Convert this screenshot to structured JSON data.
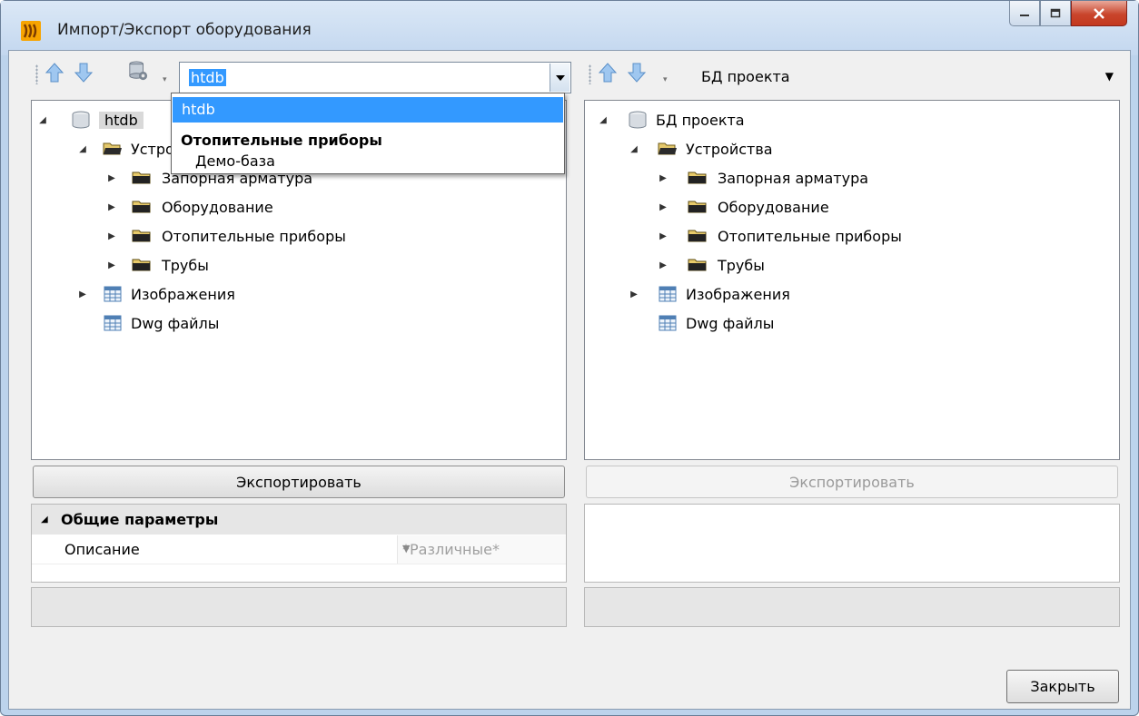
{
  "window": {
    "title": "Импорт/Экспорт оборудования",
    "accent_color": "#3399ff"
  },
  "left": {
    "db_combo": "htdb",
    "tree": {
      "root": "htdb",
      "devices": "Устройства",
      "items": [
        "Запорная арматура",
        "Оборудование",
        "Отопительные приборы",
        "Трубы"
      ],
      "images": "Изображения",
      "dwg": "Dwg файлы"
    },
    "export_label": "Экспортировать",
    "props": {
      "group": "Общие параметры",
      "row_name": "Описание",
      "row_value": "*Различные*"
    }
  },
  "right": {
    "db_combo": "БД проекта",
    "tree": {
      "root": "БД проекта",
      "devices": "Устройства",
      "items": [
        "Запорная арматура",
        "Оборудование",
        "Отопительные приборы",
        "Трубы"
      ],
      "images": "Изображения",
      "dwg": "Dwg файлы"
    },
    "export_label": "Экспортировать"
  },
  "dropdown": {
    "options": [
      "htdb",
      "Отопительные приборы",
      "Демо-база"
    ]
  },
  "close_label": "Закрыть"
}
